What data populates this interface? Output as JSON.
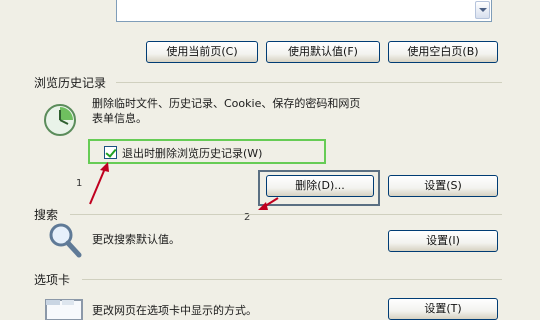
{
  "home": {
    "use_current_label": "使用当前页(C)",
    "use_default_label": "使用默认值(F)",
    "use_blank_label": "使用空白页(B)"
  },
  "history": {
    "title": "浏览历史记录",
    "description_line1": "删除临时文件、历史记录、Cookie、保存的密码和网页",
    "description_line2": "表单信息。",
    "checkbox_label": "退出时删除浏览历史记录(W)",
    "checkbox_checked": true,
    "delete_label": "删除(D)...",
    "settings_label": "设置(S)",
    "icon": "history-clock-icon"
  },
  "search": {
    "title": "搜索",
    "description": "更改搜索默认值。",
    "settings_label": "设置(I)",
    "icon": "magnifier-icon"
  },
  "tabs": {
    "title": "选项卡",
    "description": "更改网页在选项卡中显示的方式。",
    "settings_label": "设置(T)",
    "icon": "tabs-window-icon"
  },
  "annotations": {
    "step1": "1",
    "step2": "2",
    "highlight_color": "#66cc55",
    "arrow_color": "#c0001f"
  }
}
